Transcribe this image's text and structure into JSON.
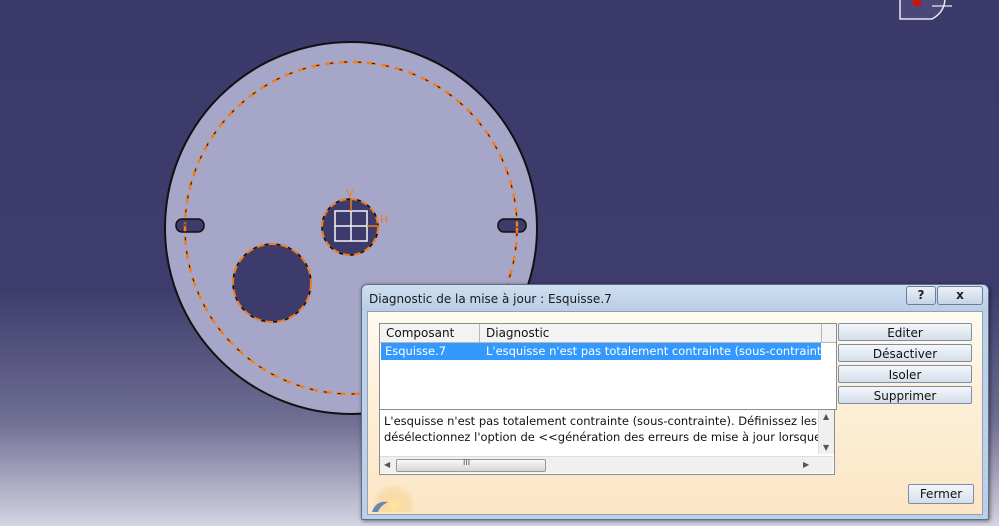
{
  "dialog": {
    "title": "Diagnostic de la mise à jour : Esquisse.7",
    "help_label": "?",
    "close_label": "x",
    "columns": [
      "Composant",
      "Diagnostic"
    ],
    "rows": [
      {
        "component": "Esquisse.7",
        "diagnostic": "L'esquisse n'est pas totalement contrainte (sous-contrainte). ..."
      }
    ],
    "message_lines": [
      "L'esquisse n'est pas totalement contrainte (sous-contrainte).  Définissez les contra",
      "désélectionnez l'option de <<génération des erreurs de mise à jour lorsque l'esqui"
    ],
    "buttons": {
      "edit": "Editer",
      "deactivate": "Désactiver",
      "isolate": "Isoler",
      "delete": "Supprimer",
      "close": "Fermer"
    },
    "hscroll_grip": "III"
  },
  "sketch": {
    "axis_v_label": "V",
    "axis_h_label": "H"
  },
  "colors": {
    "background": "#3c3a6a",
    "part_fill": "#a6a6c8",
    "profile_orange": "#f07d20",
    "selection": "#3399ff"
  }
}
